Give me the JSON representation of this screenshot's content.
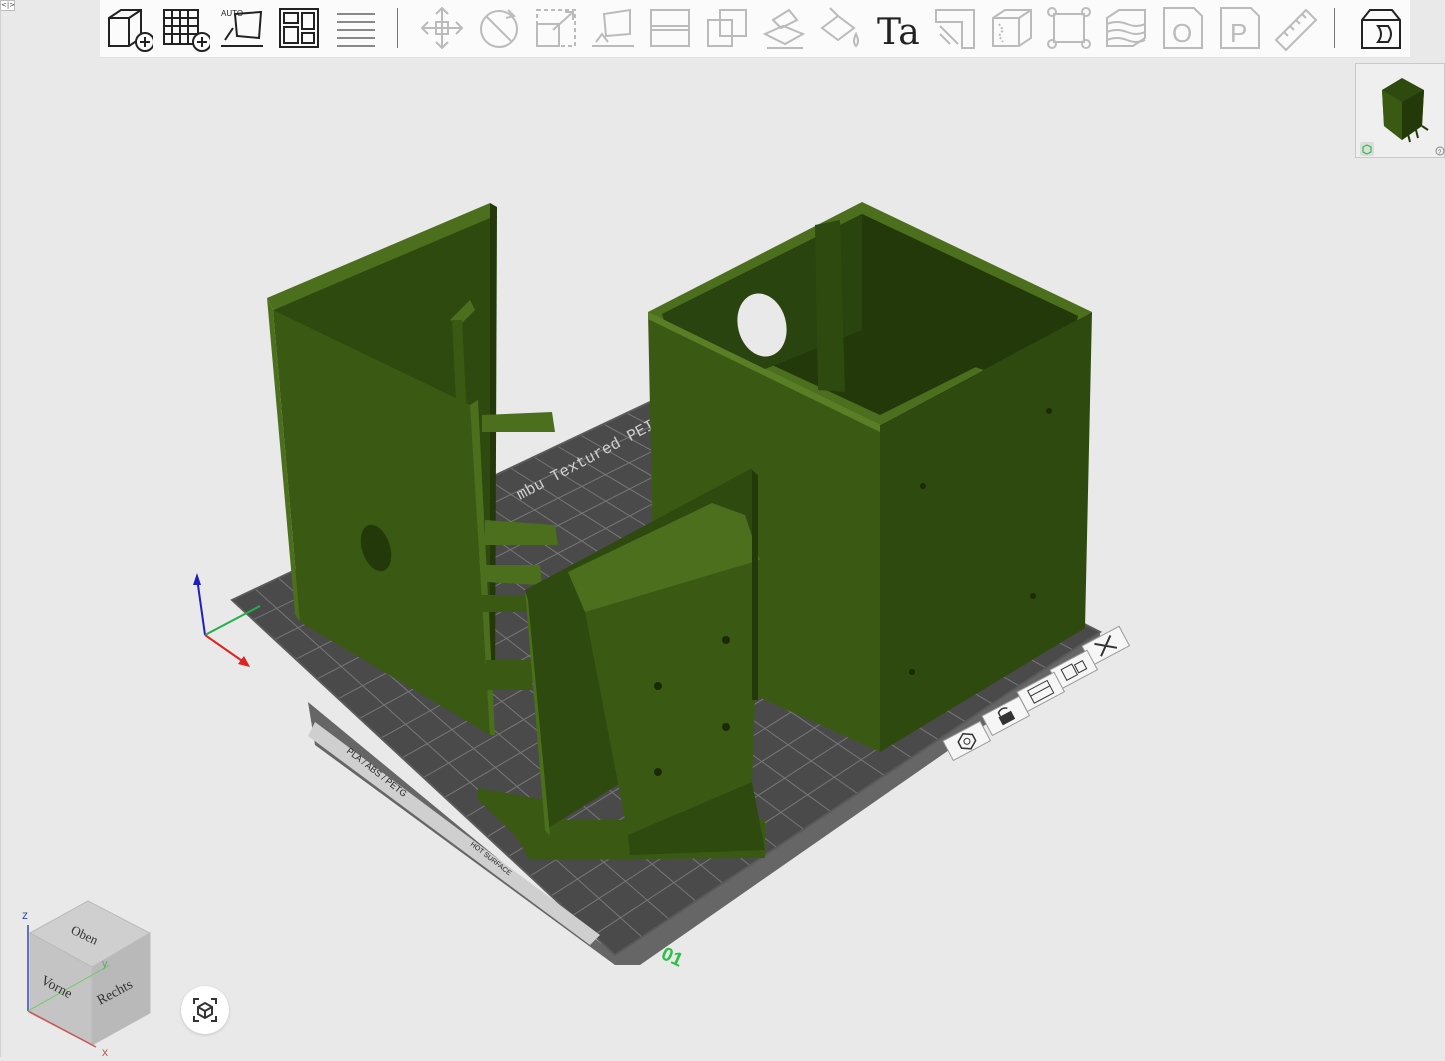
{
  "colors": {
    "model_green": "#3a5a14",
    "model_dark": "#23390a",
    "model_light": "#4c6f1e",
    "plate": "#4a4a4a",
    "plate_grid": "#777777",
    "plate_index": "#2bbf44",
    "viewport_bg": "#e9e9e9"
  },
  "toolbar": {
    "left_group": [
      "add-object-icon",
      "add-plate-icon",
      "auto-orient-icon",
      "arrange-icon",
      "split-layers-icon"
    ],
    "right_group": [
      "move-icon",
      "rotate-icon",
      "scale-icon",
      "lay-on-face-icon",
      "cut-icon",
      "boolean-icon",
      "support-paint-icon",
      "color-paint-icon",
      "text-icon",
      "seam-icon",
      "fuzzy-skin-icon",
      "variable-height-icon",
      "measure-range-icon",
      "plate-o-icon",
      "plate-p-icon",
      "ruler-icon"
    ],
    "auto_label": "AUTO",
    "text_tool_label": "Ta",
    "plate_o_label": "O",
    "plate_p_label": "P",
    "assembly_icon": "assembly-view-icon"
  },
  "plate": {
    "index_label": "01",
    "texture_label": "mbu Textured PEI",
    "material_label": "PLA / ABS / PETG",
    "hot_surface_label": "HOT SURFACE"
  },
  "plate_actions": [
    "close-plate-icon",
    "auto-arrange-icon",
    "plate-settings-icon",
    "lock-plate-icon",
    "orient-plate-icon"
  ],
  "navcube": {
    "top": "Oben",
    "front": "Vorne",
    "right": "Rechts",
    "axis_z": "z",
    "axis_y": "y",
    "axis_x": "x"
  },
  "thumbnail_tooltip": "?"
}
